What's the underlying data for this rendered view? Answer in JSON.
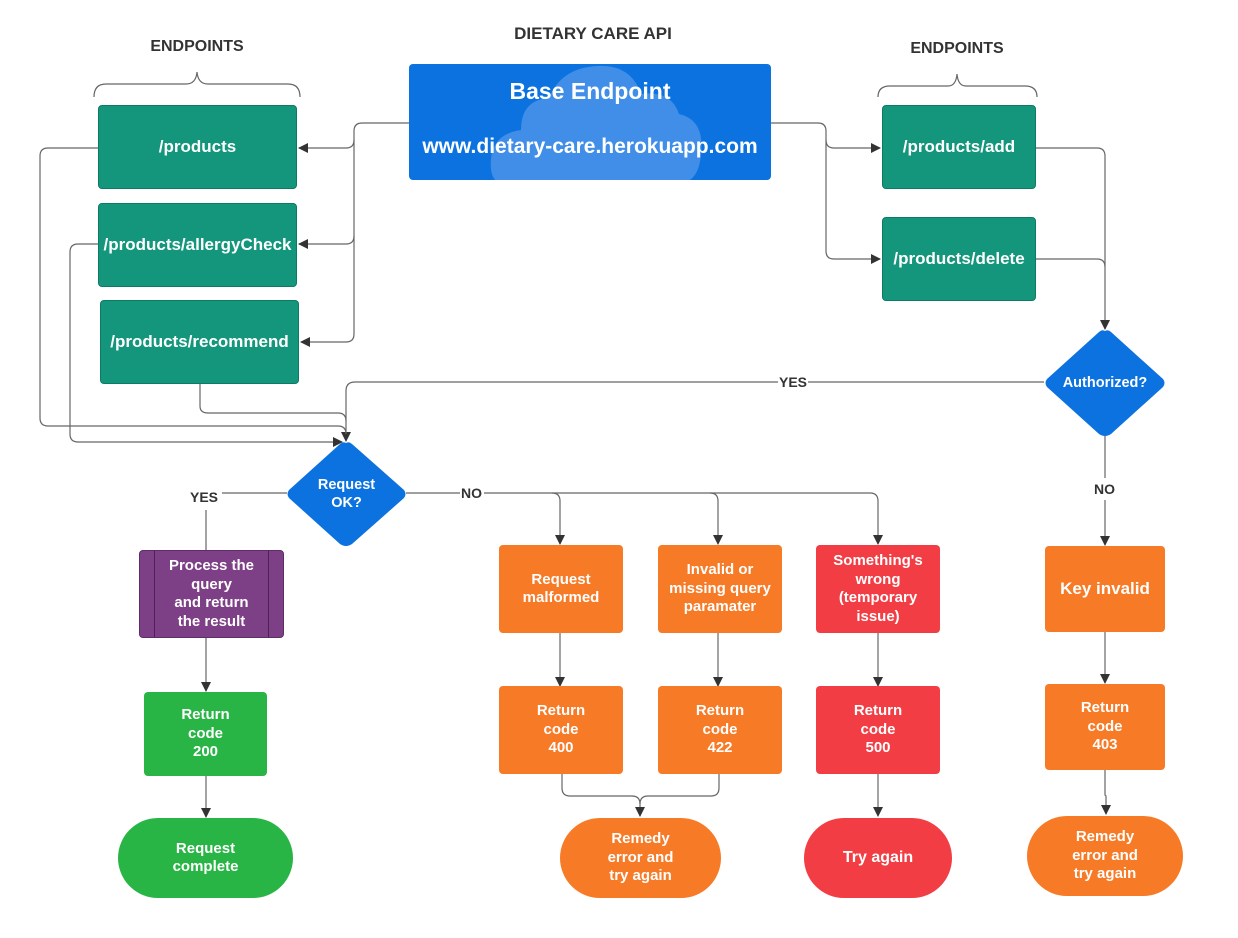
{
  "title": "DIETARY CARE API",
  "base_endpoint": {
    "title": "Base Endpoint",
    "url": "www.dietary-care.herokuapp.com"
  },
  "left_group": {
    "heading": "ENDPOINTS",
    "endpoints": [
      "/products",
      "/products/allergyCheck",
      "/products/recommend"
    ]
  },
  "right_group": {
    "heading": "ENDPOINTS",
    "endpoints": [
      "/products/add",
      "/products/delete"
    ]
  },
  "decisions": {
    "authorized": "Authorized?",
    "request_ok": "Request\nOK?"
  },
  "edge_labels": {
    "authorized_yes": "YES",
    "authorized_no": "NO",
    "request_yes": "YES",
    "request_no": "NO"
  },
  "success_path": {
    "process": "Process the\nquery\nand return\nthe result",
    "return_code": "Return\ncode\n 200",
    "terminal": "Request\ncomplete"
  },
  "error_paths": {
    "malformed": {
      "cause": "Request\nmalformed",
      "return_code": "Return\ncode\n400"
    },
    "invalid_param": {
      "cause": "Invalid or\nmissing query\nparamater",
      "return_code": "Return\ncode\n422"
    },
    "remedy_terminal": "Remedy\nerror and\ntry again",
    "server_error": {
      "cause": "Something's\nwrong\n(temporary\nissue)",
      "return_code": "Return\ncode\n500",
      "terminal": "Try again"
    }
  },
  "auth_failure_path": {
    "cause": "Key invalid",
    "return_code": "Return\ncode\n403",
    "terminal": "Remedy\nerror and\ntry again"
  },
  "colors": {
    "endpoint": "#13967b",
    "base": "#0b72e0",
    "decision": "#0b72e0",
    "process": "#7d3f86",
    "success": "#29b546",
    "client_error": "#f77a26",
    "server_error": "#f23d44",
    "connector": "#555555"
  }
}
